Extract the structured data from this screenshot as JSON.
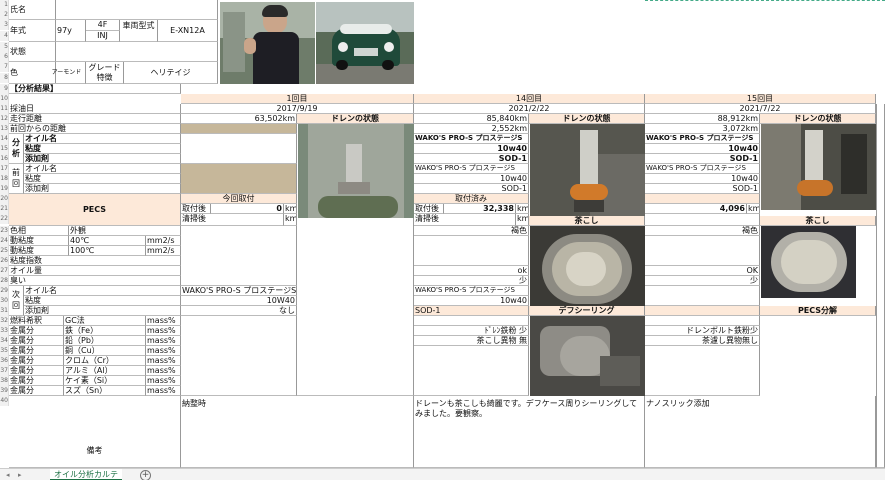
{
  "sheet": {
    "tab_name": "オイル分析カルテ",
    "add_sheet": "+"
  },
  "info": {
    "name_label": "氏名",
    "year_label": "年式",
    "year_value": "97y",
    "engine_top": "4F",
    "engine_bottom": "INJ",
    "vehicle_type_label": "車両型式",
    "model_code": "E-XN12A",
    "status_label": "状態",
    "color_label": "色",
    "color_value": "アーモンド",
    "grade_label": "グレード特徴",
    "grade_value": "ヘリテイジ"
  },
  "section_title": "【分析結果】",
  "columns": [
    {
      "round": "1回目",
      "date": "2017/9/19",
      "mileage": "63,502km",
      "drain_title": "ドレンの状態",
      "oil_name": "",
      "viscosity": "",
      "additive": "",
      "prev_oil": "",
      "prev_visc": "",
      "prev_add": "",
      "pecs_status": "今回取付",
      "attach_label": "取付後",
      "attach_value": "0",
      "clean_label": "清掃後",
      "unit": "km",
      "color": "",
      "water": "",
      "odor": "",
      "next_oil": "WAKO'S PRO-S プロステージS",
      "next_visc": "10W40",
      "next_add": "なし",
      "remarks": "納整時"
    },
    {
      "round": "14回目",
      "date": "2021/2/22",
      "mileage": "85,840km",
      "since": "2,552km",
      "drain_title": "ドレンの状態",
      "oil_name": "WAKO'S PRO-S プロステージS",
      "viscosity": "10w40",
      "additive": "SOD-1",
      "prev_oil": "WAKO'S PRO-S プロステージS",
      "prev_visc": "10w40",
      "prev_add": "SOD-1",
      "pecs_status": "取付済み",
      "attach_label": "取付後",
      "attach_value": "32,338",
      "clean_label": "清掃後",
      "unit": "km",
      "color": "褐色",
      "water": "ok",
      "odor": "少",
      "next_oil": "WAKO'S PRO-S プロステージS",
      "next_visc": "10w40",
      "next_add": "SOD-1",
      "strainer_title": "茶こし",
      "diff_title": "デフシーリング",
      "metal_note1": "ﾄﾞﾚﾝ鉄粉 少",
      "metal_note2": "茶こし異物 無",
      "remarks": "ドレーンも茶こしも綺麗です。デフケース周りシーリングしてみました。要観察。"
    },
    {
      "round": "15回目",
      "date": "2021/7/22",
      "mileage": "88,912km",
      "since": "3,072km",
      "drain_title": "ドレンの状態",
      "oil_name": "WAKO'S PRO-S プロステージS",
      "viscosity": "10w40",
      "additive": "SOD-1",
      "prev_oil": "WAKO'S PRO-S プロステージS",
      "prev_visc": "10w40",
      "prev_add": "SOD-1",
      "pecs_status": "",
      "attach_label": "",
      "attach_value": "4,096",
      "clean_label": "",
      "unit": "km",
      "color": "褐色",
      "water": "OK",
      "odor": "少",
      "next_oil": "",
      "next_visc": "",
      "next_add": "",
      "strainer_title": "茶こし",
      "pecs_title": "PECS分解",
      "metal_note1": "ドレンボルト鉄粉少",
      "metal_note2": "茶濾し異物無し",
      "remarks": "ナノスリック添加"
    }
  ],
  "labels": {
    "date": "採油日",
    "mileage": "走行距離",
    "since_prev": "前回からの距離",
    "analysis": "分析",
    "oil_name": "オイル名",
    "viscosity": "粘度",
    "additive": "添加剤",
    "prev": "前回",
    "pecs": "PECS",
    "color": "色相",
    "appearance": "外観",
    "kinvisc": "動粘度",
    "t40": "40℃",
    "t100": "100℃",
    "unit_mm2": "mm2/s",
    "vi": "粘度指数",
    "water": "オイル量",
    "odor": "臭い",
    "next": "次回",
    "fuel": "燃料希釈",
    "gc": "GC法",
    "metal": "金属分",
    "iron": "鉄（Fe）",
    "lead": "鉛（Pb）",
    "copper": "銅（Cu）",
    "chrome": "クロム（Cr）",
    "al": "アルミ（Al）",
    "si": "ケイ素（Si）",
    "sn": "スズ（Sn）",
    "mass": "mass%",
    "remarks": "備考"
  },
  "rows": [
    "1",
    "2",
    "3",
    "4",
    "5",
    "6",
    "7",
    "8",
    "9",
    "10",
    "11",
    "12",
    "13",
    "14",
    "15",
    "16",
    "17",
    "18",
    "19",
    "20",
    "21",
    "22",
    "23",
    "24",
    "25",
    "26",
    "27",
    "28",
    "29",
    "30",
    "31",
    "32",
    "33",
    "34",
    "35",
    "36",
    "37",
    "38",
    "39",
    "40"
  ]
}
